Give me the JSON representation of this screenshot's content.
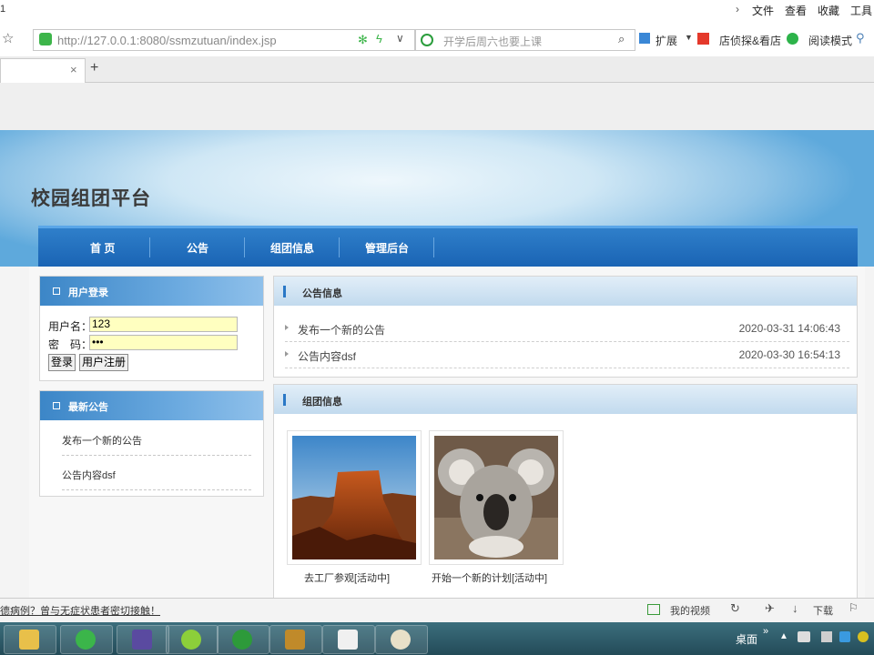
{
  "browser": {
    "tab_fragment": "1",
    "menu": [
      "文件",
      "查看",
      "收藏",
      "工具"
    ],
    "url": "http://127.0.0.1:8080/ssmzutuan/index.jsp",
    "search_placeholder": "开学后周六也要上课",
    "toolbar": {
      "extend_label": "扩展",
      "shop_label": "店侦探&看店",
      "reading_label": "阅读模式"
    },
    "new_tab_symbol": "+",
    "close_tab_symbol": "×"
  },
  "site": {
    "title": "校园组团平台",
    "nav": [
      "首 页",
      "公告",
      "组团信息",
      "管理后台"
    ]
  },
  "login": {
    "header": "用户登录",
    "username_label": "用户名：",
    "username_value": "123",
    "password_label": "密　码：",
    "password_value": "•••",
    "login_button": "登录",
    "register_button": "用户注册"
  },
  "latest_announcements": {
    "header": "最新公告",
    "items": [
      "发布一个新的公告",
      "公告内容dsf"
    ]
  },
  "announcements": {
    "header": "公告信息",
    "rows": [
      {
        "title": "发布一个新的公告",
        "date": "2020-03-31 14:06:43"
      },
      {
        "title": "公告内容dsf",
        "date": "2020-03-30 16:54:13"
      }
    ]
  },
  "groups": {
    "header": "组团信息",
    "items": [
      {
        "label": "去工厂参观[活动中]",
        "image": "desert-rock-photo"
      },
      {
        "label": "开始一个新的计划[活动中]",
        "image": "koala-photo"
      }
    ]
  },
  "statusbar": {
    "left_text": "德病例？曾与无症状患者密切接触！",
    "video_label": "我的视频",
    "download_label": "下载"
  },
  "taskbar": {
    "desktop_label": "桌面"
  },
  "colors": {
    "nav_blue": "#1a64b4",
    "header_blue": "#3c86c7",
    "input_yellow": "#ffffc0"
  }
}
